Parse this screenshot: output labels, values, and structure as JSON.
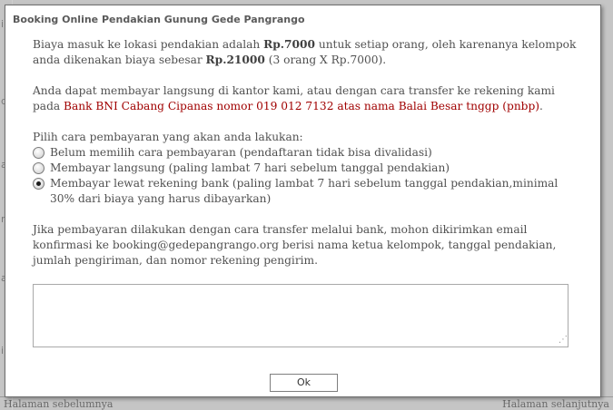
{
  "background": {
    "sidebar_fragments": [
      "i",
      "d",
      "a",
      "r",
      "a",
      "i"
    ],
    "footer": {
      "prev_label": "Halaman sebelumnya",
      "next_label": "Halaman selanjutnya"
    }
  },
  "dialog": {
    "title": "Booking Online Pendakian Gunung Gede Pangrango",
    "para1": {
      "t1": "Biaya masuk ke lokasi pendakian adalah ",
      "price_each": "Rp.7000",
      "t2": " untuk setiap orang, oleh karenanya kelompok anda dikenakan biaya sebesar ",
      "total": "Rp.21000",
      "t3": " (3 orang X Rp.7000)."
    },
    "para2": {
      "t1": "Anda dapat membayar langsung di kantor kami, atau dengan cara transfer ke rekening kami pada ",
      "bank": "Bank BNI Cabang Cipanas nomor 019 012 7132 atas nama Balai Besar tnggp (pnbp)",
      "t2": "."
    },
    "payment": {
      "prompt": "Pilih cara pembayaran yang akan anda lakukan:",
      "options": [
        {
          "label": "Belum memilih cara pembayaran   (pendaftaran tidak bisa divalidasi)",
          "checked": false
        },
        {
          "label": "Membayar langsung   (paling lambat 7 hari sebelum tanggal pendakian)",
          "checked": false
        },
        {
          "label": "Membayar lewat rekening bank   (paling lambat 7 hari sebelum tanggal pendakian,minimal 30% dari biaya yang harus dibayarkan)",
          "checked": true
        }
      ]
    },
    "para3": "Jika pembayaran dilakukan dengan cara transfer melalui bank, mohon dikirimkan email konfirmasi ke booking@gedepangrango.org berisi nama ketua kelompok, tanggal pendakian, jumlah pengiriman, dan nomor rekening pengirim.",
    "notes_value": "",
    "ok_label": "Ok"
  }
}
